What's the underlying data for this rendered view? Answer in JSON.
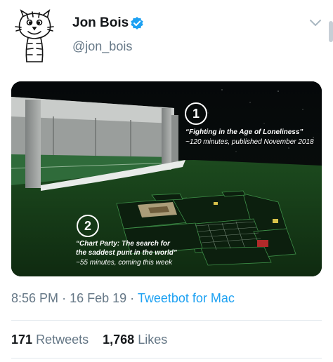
{
  "tweet": {
    "author": {
      "display_name": "Jon Bois",
      "handle": "@jon_bois",
      "verified": true,
      "avatar": "calvin-and-hobbes-tiger-drawing"
    },
    "media": {
      "caption1": {
        "number": "1",
        "title": "“Fighting in the Age of Loneliness”",
        "subtitle": "~120 minutes, published November 2018"
      },
      "caption2": {
        "number": "2",
        "title_line1": "“Chart Party: The search for",
        "title_line2": "the saddest punt in the world”",
        "subtitle": "~55 minutes, coming this week"
      }
    },
    "time": "8:56 PM",
    "date": "16 Feb 19",
    "separator": "·",
    "source": "Tweetbot for Mac",
    "retweets_count": "171",
    "retweets_label": "Retweets",
    "likes_count": "1,768",
    "likes_label": "Likes"
  },
  "colors": {
    "accent": "#1da1f2",
    "secondary_text": "#657786",
    "primary_text": "#14171a",
    "divider": "#e1e8ed"
  },
  "icons": [
    "verified-badge-icon",
    "chevron-down-icon"
  ]
}
